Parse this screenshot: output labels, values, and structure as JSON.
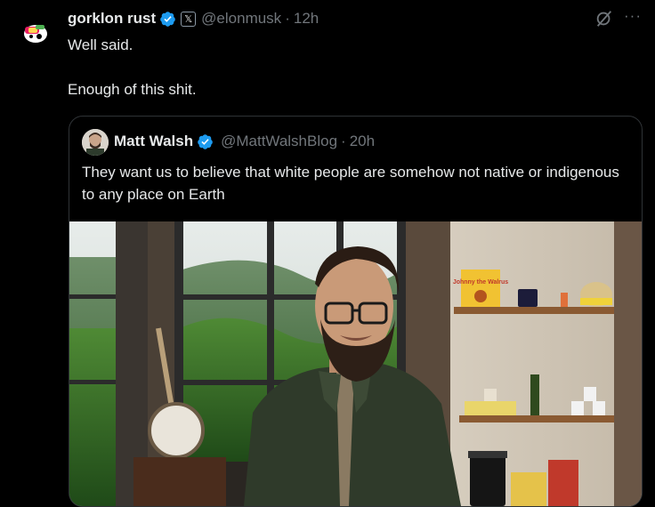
{
  "tweet": {
    "author_name": "gorklon rust",
    "affiliate_badge": "𝕏",
    "handle": "@elonmusk",
    "separator": "·",
    "time": "12h",
    "more_label": "···",
    "line1": "Well said.",
    "line2": "Enough of this shit."
  },
  "quoted": {
    "author_name": "Matt Walsh",
    "handle": "@MattWalshBlog",
    "separator": "·",
    "time": "20h",
    "text": "They want us to believe that white people are somehow not native or indigenous to any place on Earth",
    "media_book_title": "Johnny the Walrus"
  },
  "colors": {
    "verified": "#1d9bf0",
    "text": "#e7e9ea",
    "muted": "#71767b",
    "border": "#2f3336"
  },
  "icons": {
    "verified": "verified-badge-icon",
    "grok": "grok-icon",
    "more": "more-icon"
  }
}
